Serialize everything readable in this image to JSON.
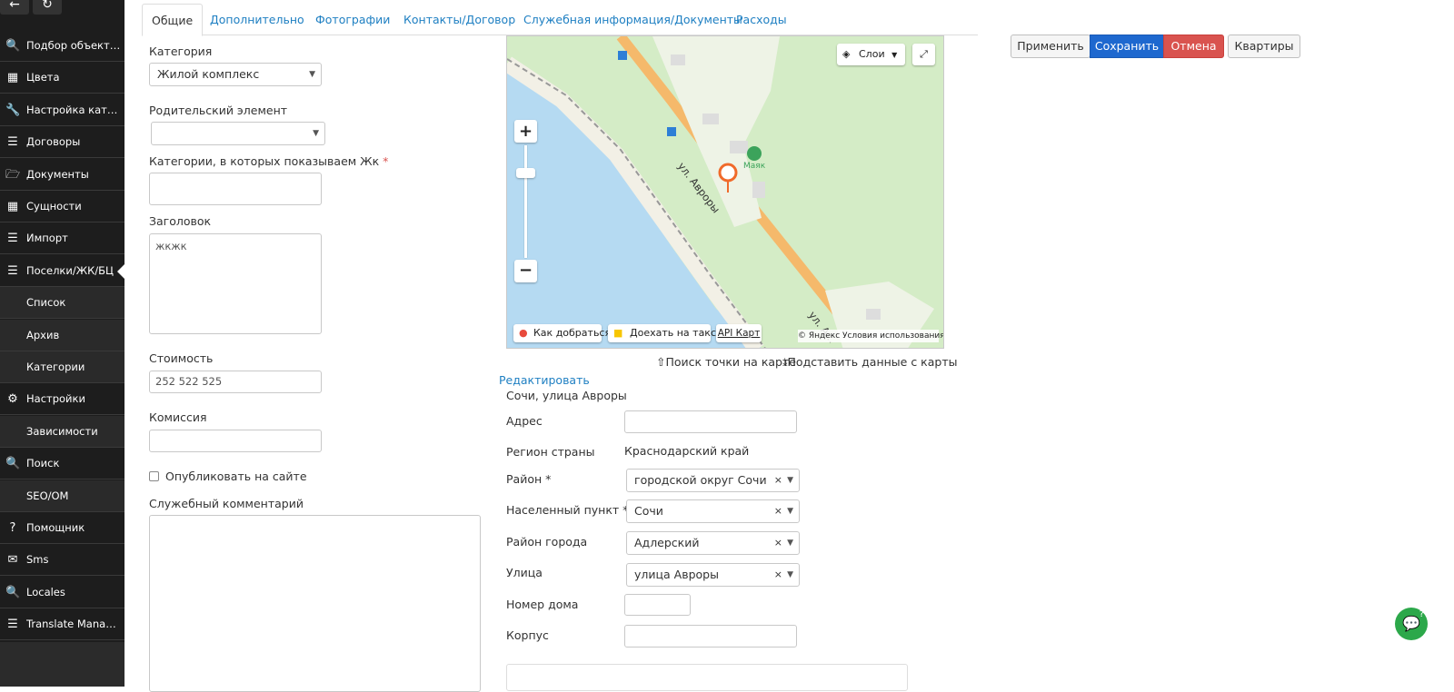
{
  "sidebar": {
    "items": [
      {
        "icon": "search-icon",
        "glyph": "🔍",
        "label": "Подбор объектов"
      },
      {
        "icon": "table-icon",
        "glyph": "▦",
        "label": "Цвета"
      },
      {
        "icon": "wrench-icon",
        "glyph": "🔧",
        "label": "Настройка категорий"
      },
      {
        "icon": "list-icon",
        "glyph": "☰",
        "label": "Договоры"
      },
      {
        "icon": "folder-icon",
        "glyph": "🗁",
        "label": "Документы"
      },
      {
        "icon": "table-icon",
        "glyph": "▦",
        "label": "Сущности"
      },
      {
        "icon": "list-icon",
        "glyph": "☰",
        "label": "Импорт"
      },
      {
        "icon": "list-icon",
        "glyph": "☰",
        "label": "Поселки/ЖК/БЦ"
      },
      {
        "icon": "",
        "glyph": "",
        "label": "Список"
      },
      {
        "icon": "",
        "glyph": "",
        "label": "Архив"
      },
      {
        "icon": "",
        "glyph": "",
        "label": "Категории"
      },
      {
        "icon": "gear-icon",
        "glyph": "⚙",
        "label": "Настройки"
      },
      {
        "icon": "",
        "glyph": "",
        "label": "Зависимости"
      },
      {
        "icon": "search-icon",
        "glyph": "🔍",
        "label": "Поиск"
      },
      {
        "icon": "",
        "glyph": "",
        "label": "SEO/OM"
      },
      {
        "icon": "question-icon",
        "glyph": "?",
        "label": "Помощник"
      },
      {
        "icon": "envelope-icon",
        "glyph": "✉",
        "label": "Sms"
      },
      {
        "icon": "search-icon",
        "glyph": "🔍",
        "label": "Locales"
      },
      {
        "icon": "list-icon",
        "glyph": "☰",
        "label": "Translate Manager"
      }
    ]
  },
  "tabs": [
    "Общие",
    "Дополнительно",
    "Фотографии",
    "Контакты/Договор",
    "Служебная информация/Документы",
    "Расходы"
  ],
  "form": {
    "category_label": "Категория",
    "category_value": "Жилой комплекс",
    "parent_label": "Родительский элемент",
    "parent_value": "",
    "show_categories_label": "Категории, в которых показываем Жк",
    "required_mark": "*",
    "title_label": "Заголовок",
    "title_value": "жкжк",
    "price_label": "Стоимость",
    "price_value": "252 522 525",
    "commission_label": "Комиссия",
    "commission_value": "",
    "publish_label": "Опубликовать на сайте",
    "comment_label": "Служебный комментарий"
  },
  "map": {
    "layers_label": "Слои",
    "street_label_1": "ул. Авроры",
    "street_label_2": "ул. А...",
    "poi_label": "Маяк",
    "route_label": "Как добраться",
    "taxi_label": "Доехать на такси",
    "api_label": "API Карт",
    "copyright": "© Яндекс Условия использования",
    "search_point": "Поиск точки на карте",
    "fill_from_map": "Подставить данные с карты"
  },
  "address": {
    "edit_link": "Редактировать",
    "full_address": "Сочи, улица Авроры",
    "address_label": "Адрес",
    "address_value": "",
    "region_label": "Регион страны",
    "region_value": "Краснодарский край",
    "district_label": "Район *",
    "district_value": "городской округ Сочи",
    "locality_label": "Населенный пункт *",
    "locality_value": "Сочи",
    "city_district_label": "Район города",
    "city_district_value": "Адлерский",
    "street_label": "Улица",
    "street_value": "улица Авроры",
    "house_label": "Номер дома",
    "house_value": "",
    "building_label": "Корпус",
    "building_value": ""
  },
  "actions": {
    "apply": "Применить",
    "save": "Сохранить",
    "cancel": "Отмена",
    "apartments": "Квартиры"
  },
  "chat": {
    "badge": "?"
  }
}
